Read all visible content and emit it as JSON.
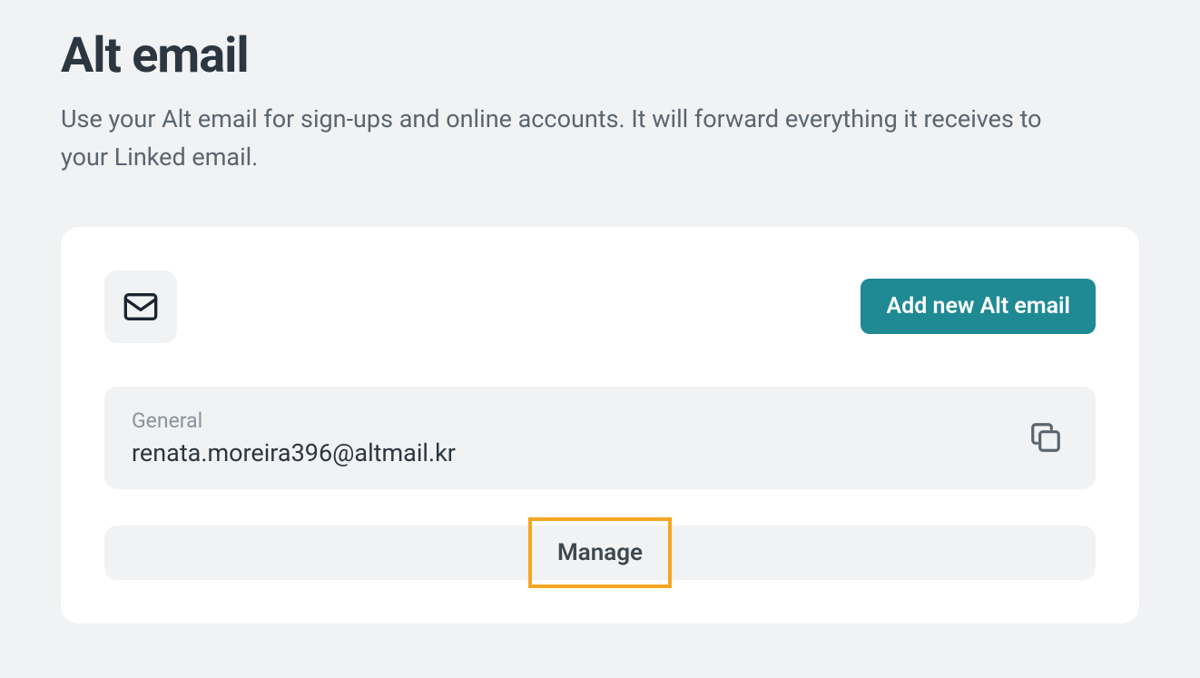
{
  "header": {
    "title": "Alt email",
    "description": "Use your Alt email for sign-ups and online accounts. It will forward everything it receives to your Linked email."
  },
  "card": {
    "add_button_label": "Add new Alt email",
    "email": {
      "label": "General",
      "value": "renata.moreira396@altmail.kr"
    },
    "manage_button_label": "Manage"
  }
}
